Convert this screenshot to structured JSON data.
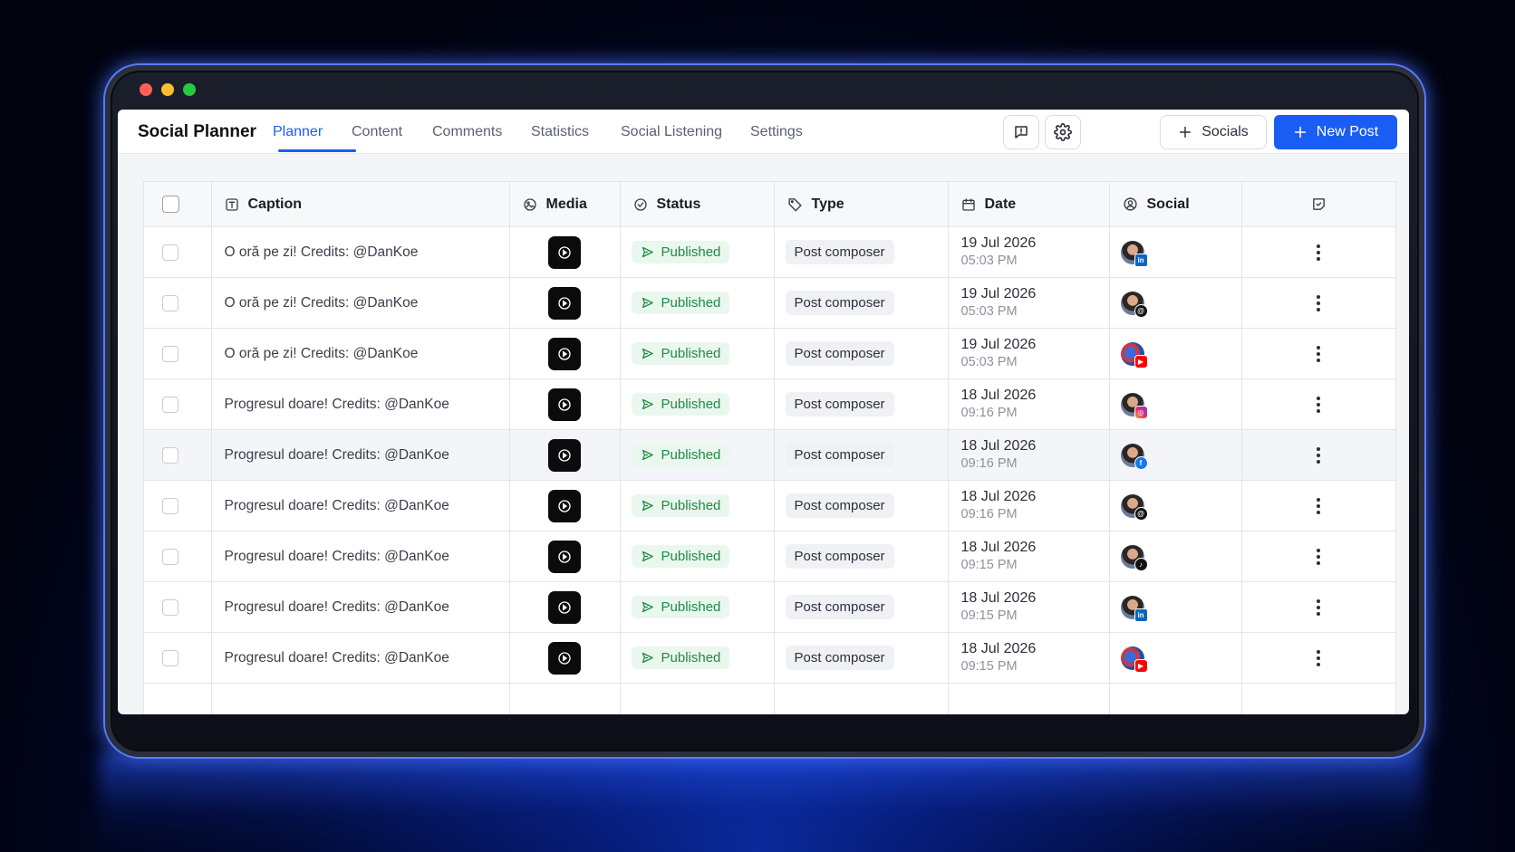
{
  "app": {
    "title": "Social Planner"
  },
  "nav": {
    "tabs": [
      {
        "label": "Planner",
        "active": true
      },
      {
        "label": "Content",
        "active": false
      },
      {
        "label": "Comments",
        "active": false
      },
      {
        "label": "Statistics",
        "active": false
      },
      {
        "label": "Social Listening",
        "active": false
      },
      {
        "label": "Settings",
        "active": false
      }
    ]
  },
  "toolbar": {
    "feedback_icon": "message-alert-icon",
    "settings_icon": "gear-icon",
    "socials_label": "Socials",
    "new_post_label": "New Post"
  },
  "table": {
    "columns": {
      "caption": "Caption",
      "media": "Media",
      "status": "Status",
      "type": "Type",
      "date": "Date",
      "social": "Social"
    },
    "rows": [
      {
        "caption": "O oră pe zi! Credits: @DanKoe",
        "status": "Published",
        "type": "Post composer",
        "date": "19 Jul 2026",
        "time": "05:03 PM",
        "network": "linkedin"
      },
      {
        "caption": "O oră pe zi! Credits: @DanKoe",
        "status": "Published",
        "type": "Post composer",
        "date": "19 Jul 2026",
        "time": "05:03 PM",
        "network": "threads"
      },
      {
        "caption": "O oră pe zi! Credits: @DanKoe",
        "status": "Published",
        "type": "Post composer",
        "date": "19 Jul 2026",
        "time": "05:03 PM",
        "network": "youtube"
      },
      {
        "caption": "Progresul doare! Credits: @DanKoe",
        "status": "Published",
        "type": "Post composer",
        "date": "18 Jul 2026",
        "time": "09:16 PM",
        "network": "instagram"
      },
      {
        "caption": "Progresul doare! Credits: @DanKoe",
        "status": "Published",
        "type": "Post composer",
        "date": "18 Jul 2026",
        "time": "09:16 PM",
        "network": "facebook"
      },
      {
        "caption": "Progresul doare! Credits: @DanKoe",
        "status": "Published",
        "type": "Post composer",
        "date": "18 Jul 2026",
        "time": "09:16 PM",
        "network": "threads"
      },
      {
        "caption": "Progresul doare! Credits: @DanKoe",
        "status": "Published",
        "type": "Post composer",
        "date": "18 Jul 2026",
        "time": "09:15 PM",
        "network": "tiktok"
      },
      {
        "caption": "Progresul doare! Credits: @DanKoe",
        "status": "Published",
        "type": "Post composer",
        "date": "18 Jul 2026",
        "time": "09:15 PM",
        "network": "linkedin"
      },
      {
        "caption": "Progresul doare! Credits: @DanKoe",
        "status": "Published",
        "type": "Post composer",
        "date": "18 Jul 2026",
        "time": "09:15 PM",
        "network": "youtube"
      }
    ]
  },
  "colors": {
    "accent": "#1a5df5",
    "status_published_bg": "#eaf7ee",
    "status_published_text": "#1f8a43"
  }
}
